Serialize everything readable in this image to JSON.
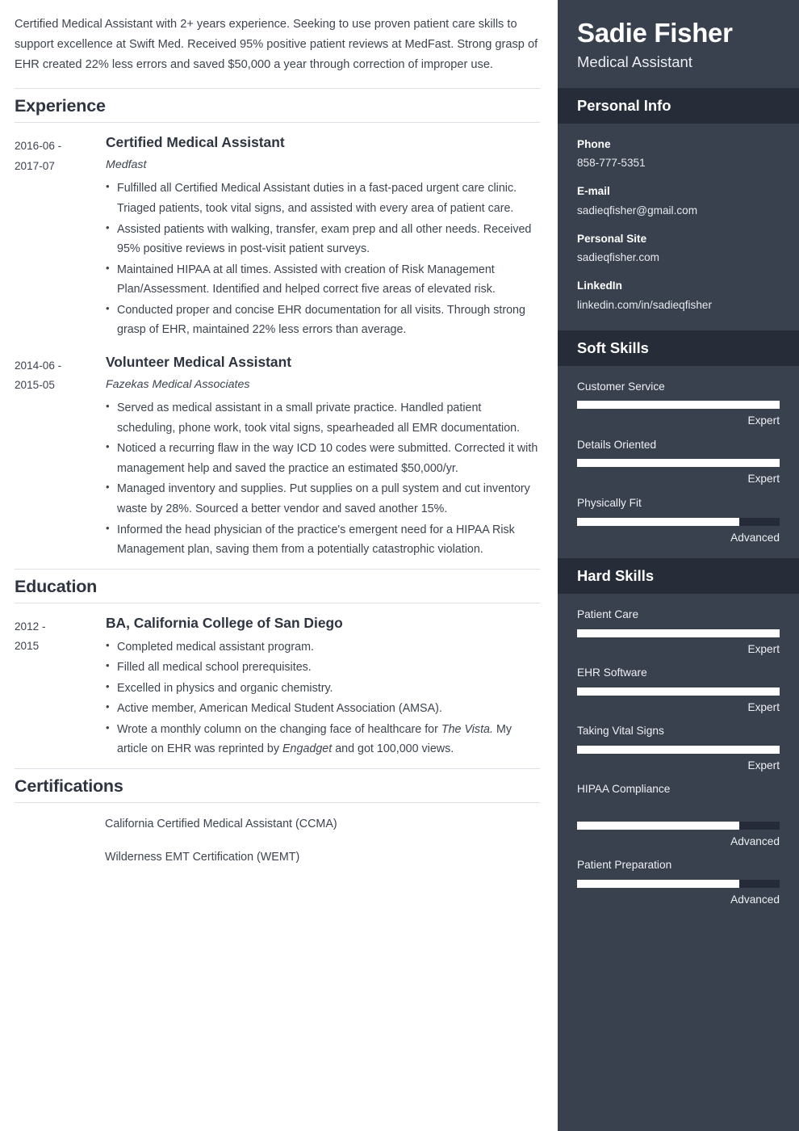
{
  "summary": "Certified Medical Assistant with 2+ years experience. Seeking to use proven patient care skills to support excellence at Swift Med. Received 95% positive patient reviews at MedFast. Strong grasp of EHR created 22% less errors and saved $50,000 a year through correction of improper use.",
  "sections": {
    "experience_title": "Experience",
    "education_title": "Education",
    "certifications_title": "Certifications"
  },
  "experience": [
    {
      "date_start": "2016-06 -",
      "date_end": "2017-07",
      "title": "Certified Medical Assistant",
      "employer": "Medfast",
      "bullets": [
        "Fulfilled all Certified Medical Assistant duties in a fast-paced urgent care clinic. Triaged patients, took vital signs, and assisted with every area of patient care.",
        "Assisted patients with walking, transfer, exam prep and all other needs. Received 95% positive reviews in post-visit patient surveys.",
        "Maintained HIPAA at all times. Assisted with creation of Risk Management Plan/Assessment. Identified and helped correct five areas of elevated risk.",
        "Conducted proper and concise EHR documentation for all visits. Through strong grasp of EHR, maintained 22% less errors than average."
      ]
    },
    {
      "date_start": "2014-06 -",
      "date_end": "2015-05",
      "title": "Volunteer Medical Assistant",
      "employer": "Fazekas Medical Associates",
      "bullets": [
        "Served as medical assistant in a small private practice. Handled patient scheduling, phone work, took vital signs, spearheaded all EMR documentation.",
        "Noticed a recurring flaw in the way ICD 10 codes were submitted. Corrected it with management help and saved the practice an estimated $50,000/yr.",
        "Managed inventory and supplies. Put supplies on a pull system and cut inventory waste by 28%. Sourced a better vendor and saved another 15%.",
        "Informed the head physician of the practice's emergent need for a HIPAA Risk Management plan, saving them from a potentially catastrophic violation."
      ]
    }
  ],
  "education": [
    {
      "date_start": "2012 -",
      "date_end": "2015",
      "title": "BA, California College of San Diego",
      "bullets": [
        "Completed medical assistant program.",
        "Filled all medical school prerequisites.",
        "Excelled in physics and organic chemistry.",
        "Active member, American Medical Student Association (AMSA)."
      ],
      "last_bullet": {
        "part1": "Wrote a monthly column on the changing face of healthcare for ",
        "italic1": "The Vista.",
        "part2": " My article on EHR was reprinted by ",
        "italic2": "Engadget",
        "part3": " and got 100,000 views."
      }
    }
  ],
  "certifications": [
    "California Certified Medical Assistant (CCMA)",
    "Wilderness EMT Certification (WEMT)"
  ],
  "sidebar": {
    "name": "Sadie Fisher",
    "role": "Medical Assistant",
    "personal_info_title": "Personal Info",
    "contacts": [
      {
        "label": "Phone",
        "value": "858-777-5351"
      },
      {
        "label": "E-mail",
        "value": "sadieqfisher@gmail.com"
      },
      {
        "label": "Personal Site",
        "value": "sadieqfisher.com"
      },
      {
        "label": "LinkedIn",
        "value": "linkedin.com/in/sadieqfisher"
      }
    ],
    "soft_skills_title": "Soft Skills",
    "soft_skills": [
      {
        "name": "Customer Service",
        "level": "Expert",
        "percent": 100
      },
      {
        "name": "Details Oriented",
        "level": "Expert",
        "percent": 100
      },
      {
        "name": "Physically Fit",
        "level": "Advanced",
        "percent": 80
      }
    ],
    "hard_skills_title": "Hard Skills",
    "hard_skills": [
      {
        "name": "Patient Care",
        "level": "Expert",
        "percent": 100
      },
      {
        "name": "EHR Software",
        "level": "Expert",
        "percent": 100
      },
      {
        "name": "Taking Vital Signs",
        "level": "Expert",
        "percent": 100
      },
      {
        "name": "HIPAA Compliance",
        "level": "Advanced",
        "percent": 80,
        "extra_gap": true
      },
      {
        "name": "Patient Preparation",
        "level": "Advanced",
        "percent": 80
      }
    ]
  },
  "colors": {
    "sidebar_bg": "#39404e",
    "sidebar_band": "#262c38",
    "bar_fill": "#ffffff",
    "bar_track": "#252b38",
    "heading": "#2e3440",
    "body_text": "#3d4450",
    "rule": "#dcdfe3"
  }
}
